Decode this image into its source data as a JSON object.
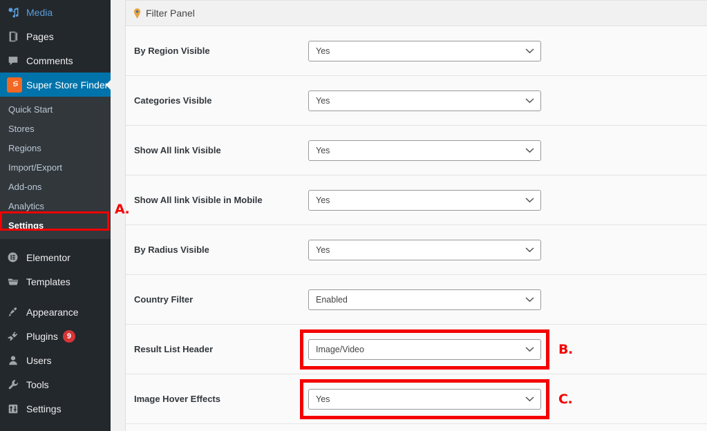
{
  "sidebar": {
    "items": [
      {
        "label": "Media",
        "icon": "media-icon",
        "style": "blue"
      },
      {
        "label": "Pages",
        "icon": "pages-icon",
        "style": "normal"
      },
      {
        "label": "Comments",
        "icon": "comments-icon",
        "style": "normal"
      }
    ],
    "active_item": {
      "label": "Super Store Finder",
      "icon": "super-store-finder-icon"
    },
    "submenu": [
      {
        "label": "Quick Start",
        "highlighted": false
      },
      {
        "label": "Stores",
        "highlighted": false
      },
      {
        "label": "Regions",
        "highlighted": false
      },
      {
        "label": "Import/Export",
        "highlighted": false
      },
      {
        "label": "Add-ons",
        "highlighted": false
      },
      {
        "label": "Analytics",
        "highlighted": false
      },
      {
        "label": "Settings",
        "highlighted": true
      }
    ],
    "lower_items": [
      {
        "label": "Elementor",
        "icon": "elementor-icon",
        "badge": ""
      },
      {
        "label": "Templates",
        "icon": "templates-icon",
        "badge": ""
      },
      {
        "label": "Appearance",
        "icon": "appearance-icon",
        "badge": ""
      },
      {
        "label": "Plugins",
        "icon": "plugins-icon",
        "badge": "9"
      },
      {
        "label": "Users",
        "icon": "users-icon",
        "badge": ""
      },
      {
        "label": "Tools",
        "icon": "tools-icon",
        "badge": ""
      },
      {
        "label": "Settings",
        "icon": "settings-icon",
        "badge": ""
      }
    ]
  },
  "panel": {
    "title": "Filter Panel",
    "title_icon": "map-pin-icon",
    "rows": [
      {
        "label": "By Region Visible",
        "value": "Yes",
        "highlighted": false
      },
      {
        "label": "Categories Visible",
        "value": "Yes",
        "highlighted": false
      },
      {
        "label": "Show All link Visible",
        "value": "Yes",
        "highlighted": false
      },
      {
        "label": "Show All link Visible in Mobile",
        "value": "Yes",
        "highlighted": false
      },
      {
        "label": "By Radius Visible",
        "value": "Yes",
        "highlighted": false
      },
      {
        "label": "Country Filter",
        "value": "Enabled",
        "highlighted": false
      },
      {
        "label": "Result List Header",
        "value": "Image/Video",
        "highlighted": true
      },
      {
        "label": "Image Hover Effects",
        "value": "Yes",
        "highlighted": true
      }
    ]
  },
  "annotations": [
    {
      "id": "a",
      "text": "A."
    },
    {
      "id": "b",
      "text": "B."
    },
    {
      "id": "c",
      "text": "C."
    }
  ],
  "colors": {
    "accent_red": "#f40000",
    "sidebar_bg": "#23282d",
    "submenu_bg": "#32373c",
    "active_blue": "#0073aa",
    "plugin_icon_orange": "#f26722",
    "badge_red": "#d63638"
  }
}
